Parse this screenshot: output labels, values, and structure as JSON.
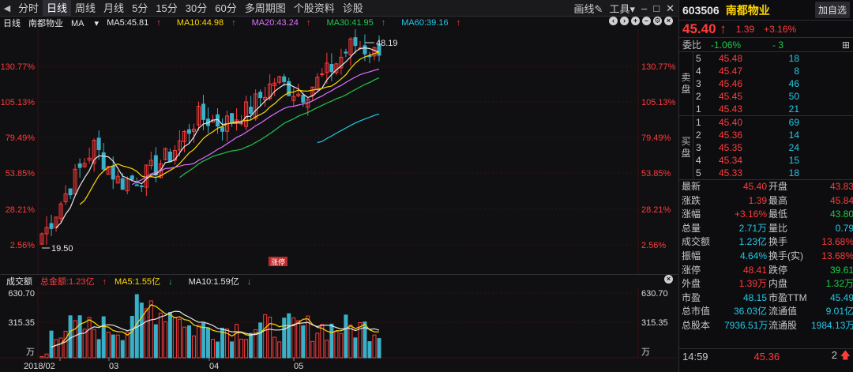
{
  "toolbar": {
    "tabs": [
      "分时",
      "日线",
      "周线",
      "月线",
      "5分",
      "15分",
      "30分",
      "60分",
      "多周期图",
      "个股资料",
      "诊股"
    ],
    "active_index": 1,
    "right": [
      "画线",
      "工具"
    ]
  },
  "kline": {
    "period": "日线",
    "stock_name": "南都物业",
    "indicator": "MA",
    "ma5": "MA5:45.81",
    "ma10": "MA10:44.98",
    "ma20": "MA20:43.24",
    "ma30": "MA30:41.95",
    "ma60": "MA60:39.16",
    "high_label": "48.19",
    "low_label": "19.50",
    "axis_labels": [
      "130.77%",
      "105.13%",
      "79.49%",
      "53.85%",
      "28.21%",
      "2.56%"
    ],
    "marker": "涨停"
  },
  "volume": {
    "title": "成交额",
    "total": "总金额:1.23亿",
    "ma5": "MA5:1.55亿",
    "ma10": "MA10:1.59亿",
    "axis_labels": [
      "630.70",
      "315.35",
      "万"
    ],
    "dates": [
      "2018/02",
      "03",
      "04",
      "05"
    ]
  },
  "colors": {
    "up": "#ff3b3b",
    "down": "#1ec84a",
    "ma5": "#e6e6e6",
    "ma10": "#ffd700",
    "ma20": "#e070ff",
    "ma30": "#1ec84a",
    "ma60": "#24c8e6",
    "hollow_up": "#ff3b3b",
    "solid_down": "#3ab0c8"
  },
  "quote": {
    "code": "603506",
    "name": "南都物业",
    "add_label": "加自选",
    "price": "45.40",
    "change": "1.39",
    "change_pct": "+3.16%",
    "ratio_label": "委比",
    "ratio_pct": "-1.06%",
    "ratio_val": "- 3",
    "sell_label": [
      "卖",
      "盘"
    ],
    "buy_label": [
      "买",
      "盘"
    ],
    "asks": [
      {
        "lvl": "5",
        "price": "45.48",
        "vol": "18"
      },
      {
        "lvl": "4",
        "price": "45.47",
        "vol": "8"
      },
      {
        "lvl": "3",
        "price": "45.46",
        "vol": "46"
      },
      {
        "lvl": "2",
        "price": "45.45",
        "vol": "50"
      },
      {
        "lvl": "1",
        "price": "45.43",
        "vol": "21"
      }
    ],
    "bids": [
      {
        "lvl": "1",
        "price": "45.40",
        "vol": "69"
      },
      {
        "lvl": "2",
        "price": "45.36",
        "vol": "14"
      },
      {
        "lvl": "3",
        "price": "45.35",
        "vol": "24"
      },
      {
        "lvl": "4",
        "price": "45.34",
        "vol": "15"
      },
      {
        "lvl": "5",
        "price": "45.33",
        "vol": "18"
      }
    ],
    "stats": [
      [
        "最新",
        "45.40",
        "开盘",
        "43.83"
      ],
      [
        "涨跌",
        "1.39",
        "最高",
        "45.84"
      ],
      [
        "涨幅",
        "+3.16%",
        "最低",
        "43.80"
      ],
      [
        "总量",
        "2.71万",
        "量比",
        "0.79"
      ],
      [
        "成交额",
        "1.23亿",
        "换手",
        "13.68%"
      ],
      [
        "振幅",
        "4.64%",
        "换手(实)",
        "13.68%"
      ],
      [
        "涨停",
        "48.41",
        "跌停",
        "39.61"
      ],
      [
        "外盘",
        "1.39万",
        "内盘",
        "1.32万"
      ],
      [
        "市盈",
        "48.15",
        "市盈TTM",
        "45.49"
      ],
      [
        "总市值",
        "36.03亿",
        "流通值",
        "9.01亿"
      ],
      [
        "总股本",
        "7936.51万",
        "流通股",
        "1984.13万"
      ]
    ],
    "last_tick": {
      "time": "14:59",
      "price": "45.36",
      "vol": "2"
    }
  }
}
